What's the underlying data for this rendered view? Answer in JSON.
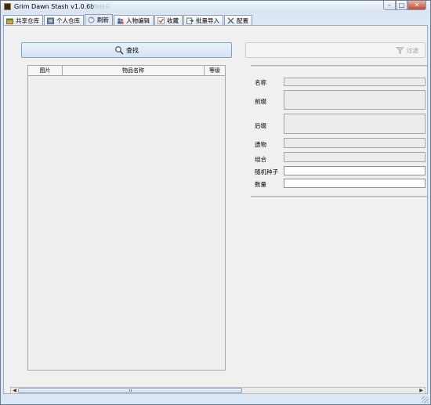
{
  "window": {
    "title": "Grim Dawn Stash v1.0.6b",
    "ghost_title": "购物快乐",
    "buttons": {
      "minimize": "–",
      "maximize": "□",
      "close": "✕"
    }
  },
  "tabs": [
    {
      "label": "共享仓库",
      "icon": "shared-stash-icon",
      "active": false
    },
    {
      "label": "个人仓库",
      "icon": "personal-stash-icon",
      "active": false
    },
    {
      "label": "刷新",
      "icon": "refresh-icon",
      "active": true
    },
    {
      "label": "人物编辑",
      "icon": "character-edit-icon",
      "active": false
    },
    {
      "label": "收藏",
      "icon": "favorites-icon",
      "active": false
    },
    {
      "label": "批量导入",
      "icon": "batch-import-icon",
      "active": false
    },
    {
      "label": "配置",
      "icon": "settings-icon",
      "active": false
    }
  ],
  "search": {
    "label": "查找",
    "icon": "magnifier-icon"
  },
  "filter": {
    "label": "过滤",
    "icon": "funnel-icon",
    "enabled": false
  },
  "item_table": {
    "columns": [
      "图片",
      "物品名称",
      "等级"
    ],
    "rows": []
  },
  "details": {
    "name_label": "名称",
    "prefix_label": "前缀",
    "suffix_label": "后缀",
    "relic_label": "遗物",
    "combo_label": "组合",
    "seed_label": "随机种子",
    "quantity_label": "数量"
  },
  "colors": {
    "window_frame": "#dbe7f5",
    "content_bg": "#f0f0f0",
    "accent_button": "#d3e3f4"
  }
}
